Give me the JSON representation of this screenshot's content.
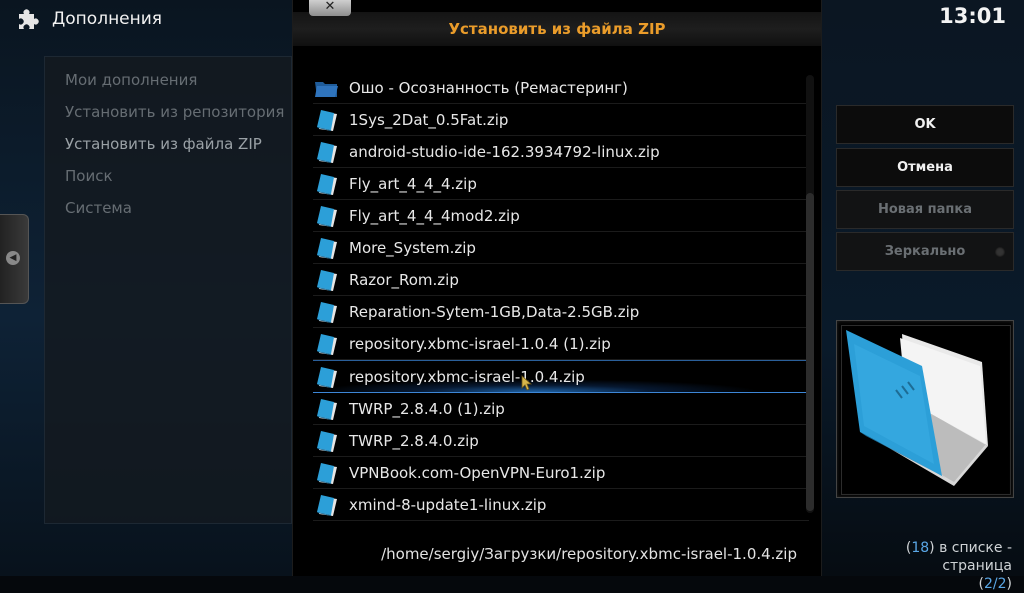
{
  "header": {
    "title": "Дополнения",
    "icon": "puzzle-icon"
  },
  "clock": "13:01",
  "left_menu": {
    "items": [
      {
        "label": "Мои дополнения",
        "active": false
      },
      {
        "label": "Установить из репозитория",
        "active": false
      },
      {
        "label": "Установить из файла ZIP",
        "active": true
      },
      {
        "label": "Поиск",
        "active": false
      },
      {
        "label": "Система",
        "active": false
      }
    ]
  },
  "dialog": {
    "close_label": "✕",
    "title": "Установить из файла ZIP",
    "files": [
      {
        "name": "Ошо - Осознанность (Ремастеринг)",
        "icon": "folder-icon",
        "focused": false
      },
      {
        "name": "1Sys_2Dat_0.5Fat.zip",
        "icon": "zip-file-icon",
        "focused": false
      },
      {
        "name": "android-studio-ide-162.3934792-linux.zip",
        "icon": "zip-file-icon",
        "focused": false
      },
      {
        "name": "Fly_art_4_4_4.zip",
        "icon": "zip-file-icon",
        "focused": false
      },
      {
        "name": "Fly_art_4_4_4mod2.zip",
        "icon": "zip-file-icon",
        "focused": false
      },
      {
        "name": "More_System.zip",
        "icon": "zip-file-icon",
        "focused": false
      },
      {
        "name": "Razor_Rom.zip",
        "icon": "zip-file-icon",
        "focused": false
      },
      {
        "name": "Reparation-Sytem-1GB,Data-2.5GB.zip",
        "icon": "zip-file-icon",
        "focused": false
      },
      {
        "name": "repository.xbmc-israel-1.0.4 (1).zip",
        "icon": "zip-file-icon",
        "focused": false
      },
      {
        "name": "repository.xbmc-israel-1.0.4.zip",
        "icon": "zip-file-icon",
        "focused": true
      },
      {
        "name": "TWRP_2.8.4.0 (1).zip",
        "icon": "zip-file-icon",
        "focused": false
      },
      {
        "name": "TWRP_2.8.4.0.zip",
        "icon": "zip-file-icon",
        "focused": false
      },
      {
        "name": "VPNBook.com-OpenVPN-Euro1.zip",
        "icon": "zip-file-icon",
        "focused": false
      },
      {
        "name": "xmind-8-update1-linux.zip",
        "icon": "zip-file-icon",
        "focused": false
      }
    ],
    "path": "/home/sergiy/Загрузки/repository.xbmc-israel-1.0.4.zip"
  },
  "buttons": {
    "ok": "OK",
    "cancel": "Отмена",
    "new_folder": "Новая папка",
    "mirror": "Зеркально"
  },
  "status": {
    "count": "18",
    "count_suffix": " в списке - страница",
    "page": "2/2"
  },
  "colors": {
    "title_accent": "#ea9c2a",
    "focus_glow": "#2f86d8",
    "count_number": "#5aa7e6"
  }
}
